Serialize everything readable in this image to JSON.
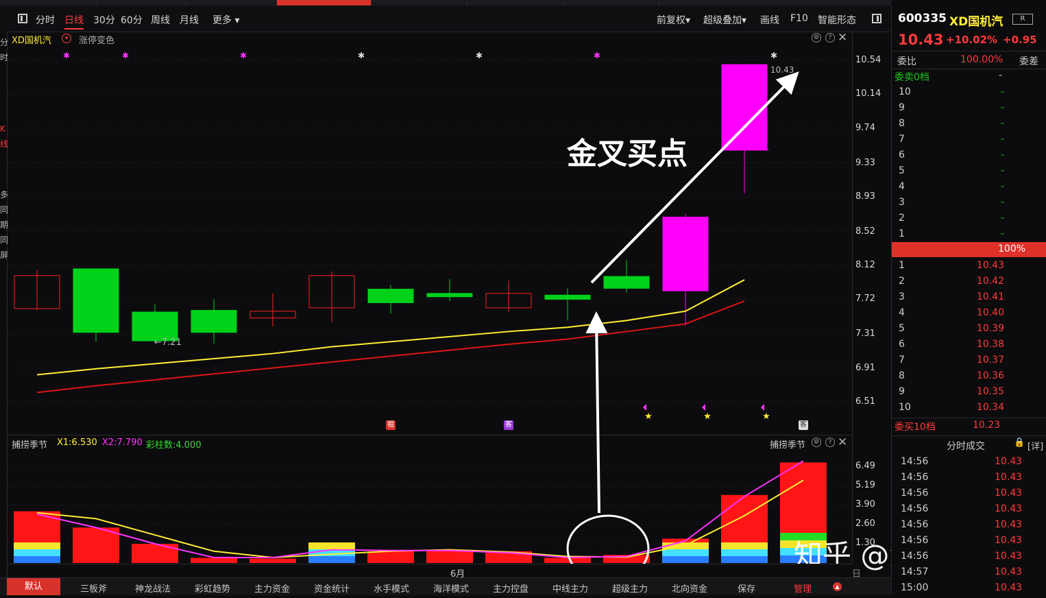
{
  "toolbar": {
    "tabs": [
      "分时",
      "日线",
      "30分",
      "60分",
      "周线",
      "月线",
      "更多"
    ],
    "active_tab": "日线",
    "right_items": [
      "前复权",
      "超级叠加",
      "画线",
      "F10",
      "智能形态"
    ]
  },
  "left_strip": [
    "分",
    "时",
    "K",
    "线",
    "多",
    "同",
    "期",
    "同",
    "屏"
  ],
  "main_panel": {
    "stock_label": "XD国机汽",
    "option_label": "涨停变色",
    "annotation_low": "←7.21",
    "annotation_high": "10.43",
    "overlay_text": "金叉买点",
    "badges": [
      "祖",
      "客",
      "客"
    ]
  },
  "sub_panel": {
    "name": "捕捞季节",
    "x1": "X1:6.530",
    "x2": "X2:7.790",
    "bars": "彩柱数:4.000",
    "right_title": "捕捞季节"
  },
  "x_axis": {
    "month_label": "6月",
    "period_label": "日线"
  },
  "bottom_tabs": [
    "默认",
    "三板斧",
    "神龙战法",
    "彩虹趋势",
    "主力资金",
    "资金统计",
    "水手模式",
    "海洋模式",
    "主力控盘",
    "中线主力",
    "超级主力",
    "北向资金",
    "保存",
    "管理"
  ],
  "active_bottom_tab": "默认",
  "watermark": "知乎 @鸿鹄财经",
  "chart_data": {
    "type": "candlestick",
    "y_ticks_main": [
      "10.54",
      "10.14",
      "9.74",
      "9.33",
      "8.93",
      "8.52",
      "8.12",
      "7.72",
      "7.31",
      "6.91",
      "6.51"
    ],
    "y_ticks_sub": [
      "6.49",
      "5.19",
      "3.90",
      "2.60",
      "1.30"
    ],
    "candles": [
      {
        "o": 7.61,
        "h": 8.07,
        "l": 7.59,
        "c": 8.0
      },
      {
        "o": 8.08,
        "h": 8.08,
        "l": 7.22,
        "c": 7.33
      },
      {
        "o": 7.57,
        "h": 7.66,
        "l": 7.21,
        "c": 7.23
      },
      {
        "o": 7.59,
        "h": 7.72,
        "l": 7.2,
        "c": 7.33
      },
      {
        "o": 7.5,
        "h": 7.79,
        "l": 7.4,
        "c": 7.58
      },
      {
        "o": 7.62,
        "h": 8.05,
        "l": 7.45,
        "c": 8.0
      },
      {
        "o": 7.84,
        "h": 7.89,
        "l": 7.55,
        "c": 7.68
      },
      {
        "o": 7.79,
        "h": 7.96,
        "l": 7.7,
        "c": 7.75
      },
      {
        "o": 7.62,
        "h": 7.94,
        "l": 7.57,
        "c": 7.79
      },
      {
        "o": 7.77,
        "h": 7.85,
        "l": 7.47,
        "c": 7.72
      },
      {
        "o": 7.99,
        "h": 8.19,
        "l": 7.8,
        "c": 7.85
      },
      {
        "o": 7.82,
        "h": 8.73,
        "l": 7.41,
        "c": 8.69
      },
      {
        "o": 9.48,
        "h": 10.43,
        "l": 8.97,
        "c": 10.49
      }
    ],
    "ma_yellow": [
      6.83,
      6.9,
      6.96,
      7.02,
      7.08,
      7.16,
      7.22,
      7.28,
      7.34,
      7.39,
      7.47,
      7.58,
      7.95
    ],
    "ma_red": [
      6.62,
      6.7,
      6.77,
      6.84,
      6.91,
      6.98,
      7.05,
      7.12,
      7.19,
      7.25,
      7.34,
      7.43,
      7.7
    ],
    "sub_bars": [
      3.5,
      2.4,
      1.3,
      0.35,
      0.3,
      1.3,
      0.8,
      0.85,
      0.8,
      0.35,
      0.55,
      1.65,
      4.6,
      6.8
    ],
    "sub_line_yellow": [
      3.4,
      3.0,
      1.9,
      0.8,
      0.3,
      0.6,
      0.8,
      0.9,
      0.75,
      0.45,
      0.4,
      1.2,
      3.2,
      5.6
    ],
    "sub_line_magenta": [
      3.3,
      2.4,
      1.3,
      0.35,
      0.25,
      0.9,
      0.85,
      0.85,
      0.7,
      0.35,
      0.45,
      1.5,
      4.5,
      6.9
    ]
  },
  "right_panel": {
    "code": "600335",
    "name": "XD国机汽",
    "badge": "R",
    "price": "10.43",
    "pct": "+10.02%",
    "change": "+0.95",
    "weibi_label": "委比",
    "weibi_value": "100.00%",
    "weicha_label": "委差",
    "sell_label": "委卖0档",
    "sell_value": "-",
    "sell_levels": [
      "10",
      "9",
      "8",
      "7",
      "6",
      "5",
      "4",
      "3",
      "2",
      "1"
    ],
    "sell_price": "-",
    "ratio_bar": "100%",
    "buy_levels": [
      {
        "level": "1",
        "price": "10.43"
      },
      {
        "level": "2",
        "price": "10.42"
      },
      {
        "level": "3",
        "price": "10.41"
      },
      {
        "level": "4",
        "price": "10.40"
      },
      {
        "level": "5",
        "price": "10.39"
      },
      {
        "level": "6",
        "price": "10.38"
      },
      {
        "level": "7",
        "price": "10.37"
      },
      {
        "level": "8",
        "price": "10.36"
      },
      {
        "level": "9",
        "price": "10.35"
      },
      {
        "level": "10",
        "price": "10.34"
      }
    ],
    "buy_label": "委买10档",
    "buy_value": "10.23",
    "trades_title": "分时成交",
    "trades_detail": "[详]",
    "trades": [
      {
        "time": "14:56",
        "price": "10.43"
      },
      {
        "time": "14:56",
        "price": "10.43"
      },
      {
        "time": "14:56",
        "price": "10.43"
      },
      {
        "time": "14:56",
        "price": "10.43"
      },
      {
        "time": "14:56",
        "price": "10.43"
      },
      {
        "time": "14:56",
        "price": "10.43"
      },
      {
        "time": "14:56",
        "price": "10.43"
      },
      {
        "time": "14:57",
        "price": "10.43"
      },
      {
        "time": "15:00",
        "price": "10.43"
      }
    ]
  },
  "colors": {
    "up": "#ff2020",
    "down": "#00d21a",
    "limit_up": "#ff00ff",
    "ma_yellow": "#ffee33",
    "ma_red": "#e01515",
    "accent": "#d8332b"
  }
}
